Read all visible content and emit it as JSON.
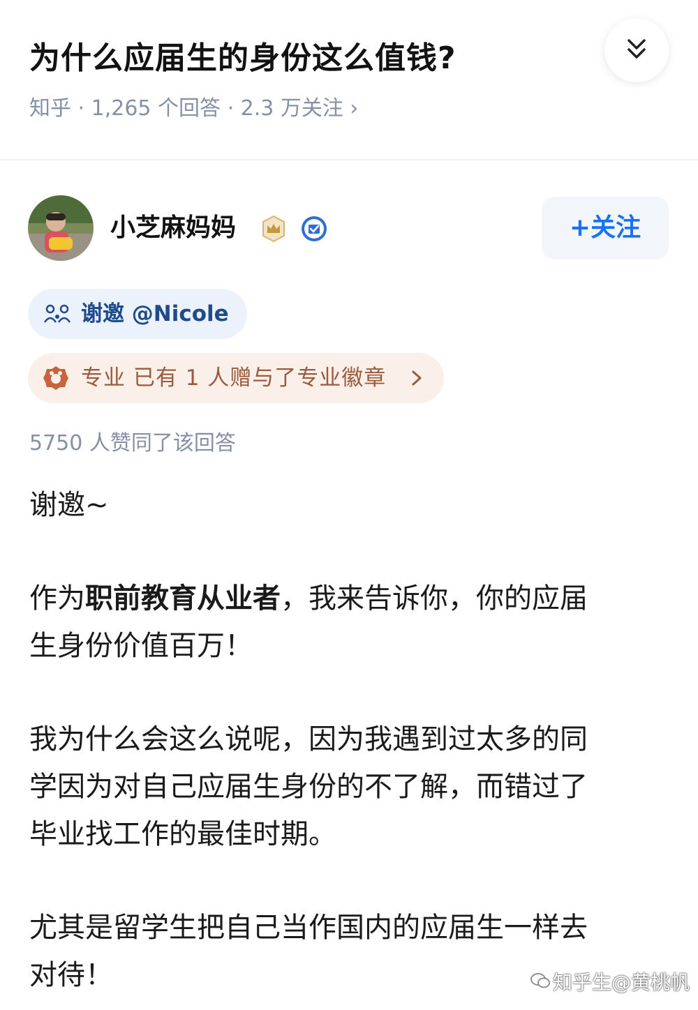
{
  "question": {
    "title": "为什么应届生的身份这么值钱?",
    "meta": "知乎 · 1,265 个回答 · 2.3 万关注 ›"
  },
  "header": {
    "collapse_icon": "double-chevron-down-icon"
  },
  "author": {
    "name": "小芝麻妈妈",
    "follow_label": "+关注",
    "badges": [
      "crown-badge-icon",
      "verified-badge-icon"
    ]
  },
  "invite": {
    "text": "谢邀 @Nicole"
  },
  "pro_badge": {
    "text": "专业 已有 1 人赠与了专业徽章"
  },
  "answer": {
    "votes": "5750 人赞同了该回答",
    "p1": "谢邀~",
    "p2_l1_pre": "作为",
    "p2_l1_bold": "职前教育从业者",
    "p2_l1_post": "，我来告诉你，你的应届",
    "p2_l2": "生身份价值百万！",
    "p3_l1": "我为什么会这么说呢，因为我遇到过太多的同",
    "p3_l2": "学因为对自己应届生身份的不了解，而错过了",
    "p3_l3": "毕业找工作的最佳时期。",
    "p4_l1": "尤其是留学生把自己当作国内的应届生一样去",
    "p4_l2": "对待！"
  },
  "watermark": {
    "text": "知乎生@黄桃帆",
    "icon": "wechat-icon"
  },
  "colors": {
    "accent": "#1772f6",
    "meta_gray": "#8590a6",
    "invite_bg": "#ebf2fb",
    "pro_bg": "#fbefe9",
    "pro_text": "#9a5a3c"
  }
}
